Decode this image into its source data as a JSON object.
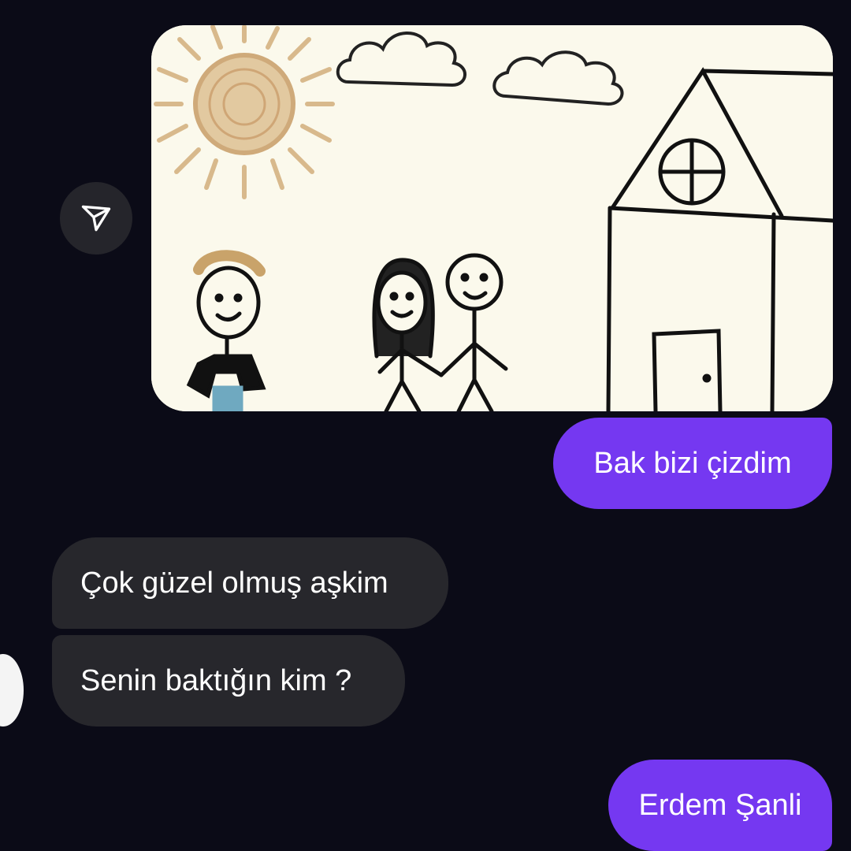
{
  "conversation": {
    "shared_image": {
      "description_icon": "child-drawing-family-house",
      "share_button_icon": "send-icon"
    },
    "messages": [
      {
        "id": "out1",
        "direction": "outgoing",
        "text": "Bak bizi çizdim"
      },
      {
        "id": "in1",
        "direction": "incoming",
        "text": "Çok güzel olmuş aşkim"
      },
      {
        "id": "in2",
        "direction": "incoming",
        "text": "Senin baktığın kim ?"
      },
      {
        "id": "out2",
        "direction": "outgoing",
        "text": "Erdem Şanli"
      }
    ]
  },
  "colors": {
    "background": "#0b0b17",
    "outgoing_bubble": "#7538f1",
    "incoming_bubble": "#27272c",
    "share_button": "#25252b"
  }
}
